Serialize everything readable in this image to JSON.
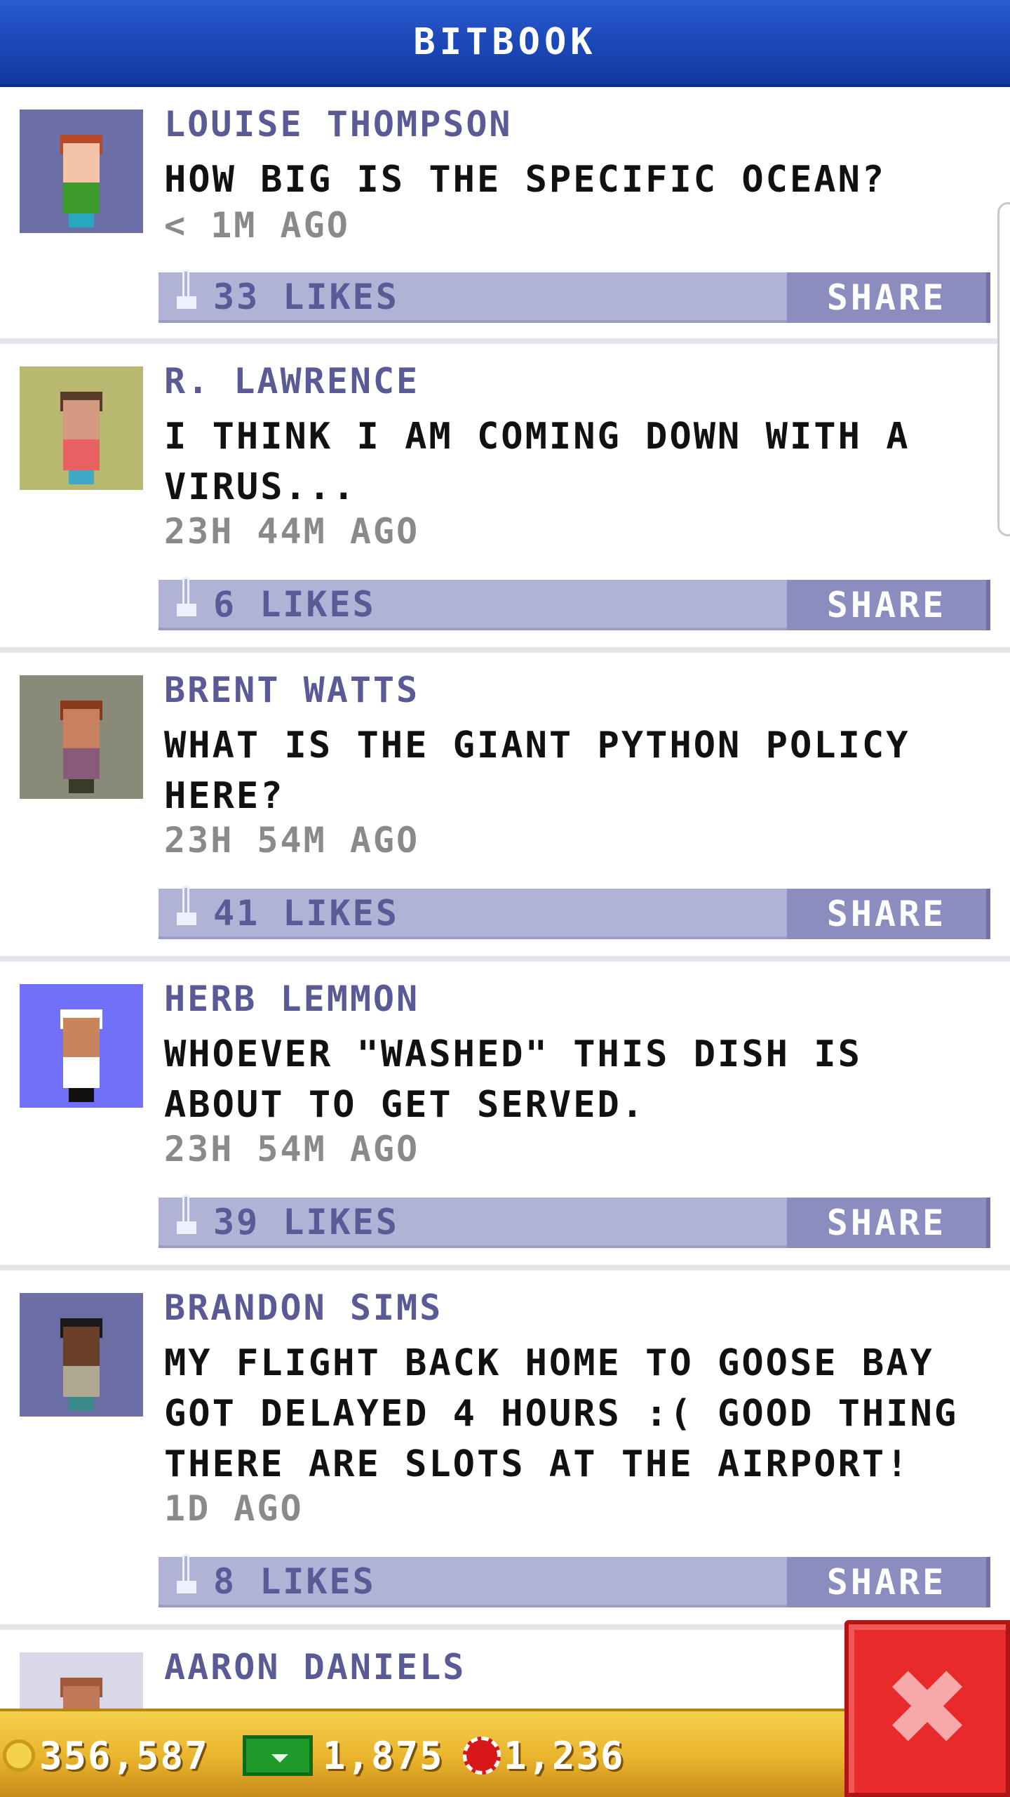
{
  "header": {
    "title": "BITBOOK"
  },
  "posts": [
    {
      "name": "LOUISE THOMPSON",
      "message": "HOW BIG IS THE SPECIFIC OCEAN?",
      "time": "< 1M AGO",
      "likes": "33 LIKES",
      "share": "SHARE",
      "avatar": {
        "bg": "#6b6fa6",
        "hair": "#b84a2a",
        "skin": "#f2c3a6",
        "shirt": "#3c9a2a",
        "legs": "#2aa8c0"
      }
    },
    {
      "name": "R. LAWRENCE",
      "message": "I THINK I AM COMING DOWN WITH A VIRUS...",
      "time": "23H 44M AGO",
      "likes": "6 LIKES",
      "share": "SHARE",
      "avatar": {
        "bg": "#b8b870",
        "hair": "#5a3a2a",
        "skin": "#d49a80",
        "shirt": "#e86060",
        "legs": "#40a8c8"
      }
    },
    {
      "name": "BRENT WATTS",
      "message": "WHAT IS THE GIANT PYTHON POLICY HERE?",
      "time": "23H 54M AGO",
      "likes": "41 LIKES",
      "share": "SHARE",
      "avatar": {
        "bg": "#8a8a78",
        "hair": "#8a3a1a",
        "skin": "#c88060",
        "shirt": "#8a5a7a",
        "legs": "#3a3a2a"
      }
    },
    {
      "name": "HERB LEMMON",
      "message": "WHOEVER \"WASHED\" THIS DISH IS ABOUT TO GET SERVED.",
      "time": "23H 54M AGO",
      "likes": "39 LIKES",
      "share": "SHARE",
      "avatar": {
        "bg": "#7070f8",
        "hair": "#ffffff",
        "skin": "#c8845a",
        "shirt": "#ffffff",
        "legs": "#111111"
      }
    },
    {
      "name": "BRANDON SIMS",
      "message": "MY FLIGHT BACK HOME TO GOOSE BAY GOT DELAYED 4 HOURS :( GOOD THING THERE ARE SLOTS AT THE AIRPORT!",
      "time": "1D AGO",
      "likes": "8 LIKES",
      "share": "SHARE",
      "avatar": {
        "bg": "#6b6fa6",
        "hair": "#1a1a1a",
        "skin": "#6a4028",
        "shirt": "#b0a890",
        "legs": "#3a8a8a"
      }
    },
    {
      "name": "AARON DANIELS",
      "message": "",
      "time": "",
      "likes": "",
      "share": "",
      "avatar": {
        "bg": "#d8d8e8",
        "hair": "#a05a3a",
        "skin": "#c07858",
        "shirt": "#c07858",
        "legs": "#c07858"
      }
    }
  ],
  "stats": {
    "coins": "356,587",
    "cash": "1,875",
    "bux": "1,236"
  },
  "icons": {
    "coin": "coin-icon",
    "cash": "cash-icon",
    "bux": "bux-icon",
    "close": "close-icon",
    "like": "thumb-up-icon"
  },
  "colors": {
    "header": "#1a45b4",
    "name": "#5a5a96",
    "like_bar": "#b0b2d6",
    "share_button": "#8b8dbf",
    "bottom_bar": "#e9b42c",
    "close_button": "#e82a2a"
  }
}
